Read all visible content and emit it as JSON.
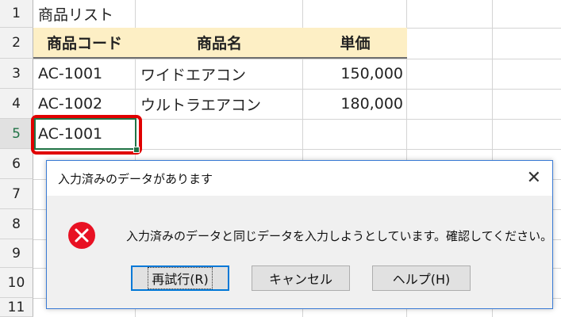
{
  "sheet": {
    "row_numbers": [
      "1",
      "2",
      "3",
      "4",
      "5",
      "6",
      "7",
      "8",
      "9",
      "10",
      "11"
    ],
    "a1": "商品リスト",
    "headers": {
      "code": "商品コード",
      "name": "商品名",
      "price": "単価"
    },
    "rows": [
      {
        "code": "AC-1001",
        "name": "ワイドエアコン",
        "price": "150,000"
      },
      {
        "code": "AC-1002",
        "name": "ウルトラエアコン",
        "price": "180,000"
      }
    ],
    "active_cell_value": "AC-1001",
    "colors": {
      "header_fill": "#fdefc5",
      "highlight_border": "#e00000",
      "selection_green": "#217346"
    }
  },
  "dialog": {
    "title": "入力済みのデータがあります",
    "close_glyph": "✕",
    "icon": "error-icon",
    "message": "入力済みのデータと同じデータを入力しようとしています。確認してください。",
    "buttons": {
      "retry": "再試行(R)",
      "cancel": "キャンセル",
      "help": "ヘルプ(H)"
    },
    "colors": {
      "error_red": "#e81123",
      "border": "#3a7bd5"
    }
  }
}
